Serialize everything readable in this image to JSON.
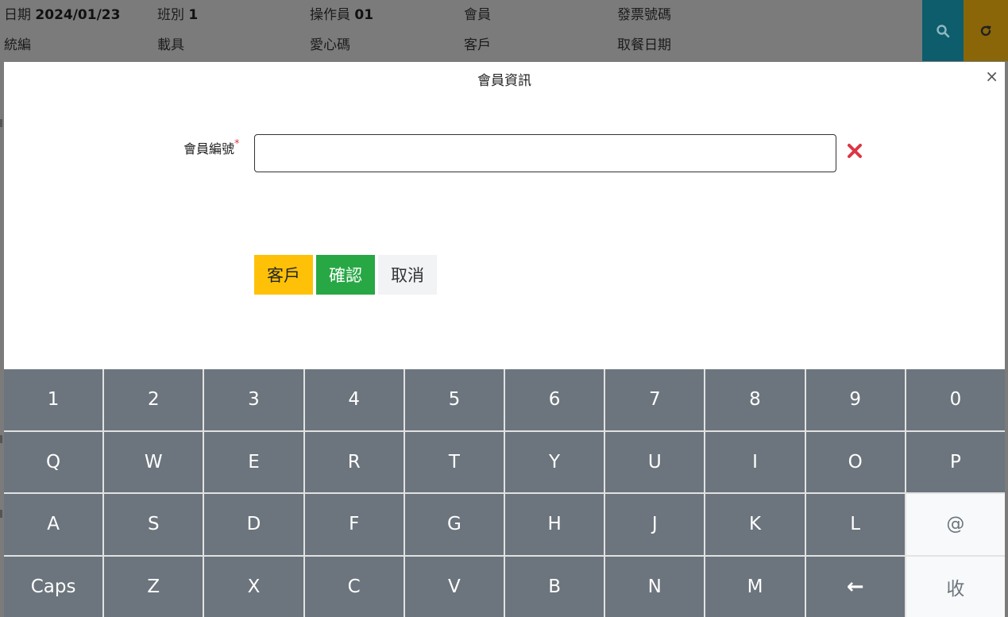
{
  "header": {
    "date_label": "日期",
    "date_value": "2024/01/23",
    "shift_label": "班別",
    "shift_value": "1",
    "operator_label": "操作員",
    "operator_value": "01",
    "member_label": "會員",
    "invoice_label": "發票號碼",
    "tax_id_label": "統編",
    "carrier_label": "載具",
    "donation_code_label": "愛心碼",
    "customer_label": "客戶",
    "pickup_date_label": "取餐日期"
  },
  "modal": {
    "title": "會員資訊",
    "close_symbol": "×",
    "member_no_label": "會員編號",
    "required_mark": "*",
    "member_no_value": "",
    "buttons": {
      "customer": "客戶",
      "confirm": "確認",
      "cancel": "取消"
    }
  },
  "keyboard": {
    "row1": [
      "1",
      "2",
      "3",
      "4",
      "5",
      "6",
      "7",
      "8",
      "9",
      "0"
    ],
    "row2": [
      "Q",
      "W",
      "E",
      "R",
      "T",
      "Y",
      "U",
      "I",
      "O",
      "P"
    ],
    "row3": [
      "A",
      "S",
      "D",
      "F",
      "G",
      "H",
      "J",
      "K",
      "L",
      "@"
    ],
    "row4": [
      "Caps",
      "Z",
      "X",
      "C",
      "V",
      "B",
      "N",
      "M",
      "←",
      "收"
    ]
  },
  "colors": {
    "search_button": "#0d5d6c",
    "refresh_button": "#8a6608",
    "customer_button": "#ffc107",
    "confirm_button": "#28a745",
    "key": "#6c757d",
    "clear_icon": "#dc3545"
  }
}
